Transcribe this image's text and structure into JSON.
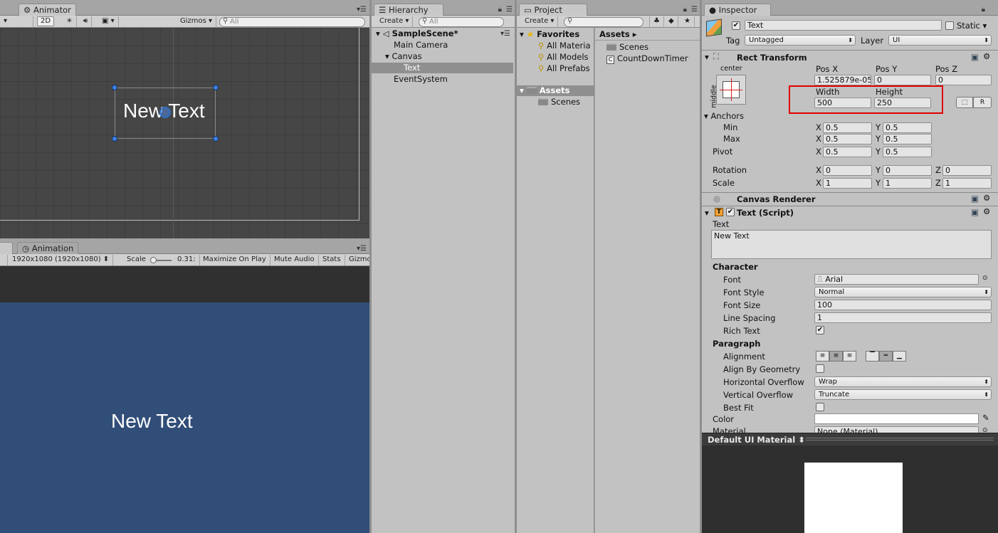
{
  "scene": {
    "tab": "Animator",
    "dim_btn": "2D",
    "gizmos": "Gizmos",
    "search_placeholder": "All",
    "text_label": "New Text"
  },
  "game": {
    "tab_animation": "Animation",
    "resolution": "1920x1080 (1920x1080)",
    "scale_label": "Scale",
    "scale_value": "0.31:",
    "maximize": "Maximize On Play",
    "mute": "Mute Audio",
    "stats": "Stats",
    "gizmos": "Gizmo",
    "text_label": "New Text",
    "bg_color": "#314e78"
  },
  "hierarchy": {
    "tab": "Hierarchy",
    "create": "Create",
    "search_placeholder": "All",
    "scene": "SampleScene*",
    "items": [
      "Main Camera",
      "Canvas",
      "Text",
      "EventSystem"
    ]
  },
  "project": {
    "tab": "Project",
    "create": "Create",
    "favorites": "Favorites",
    "fav_items": [
      "All Materia",
      "All Models",
      "All Prefabs"
    ],
    "assets_header": "Assets",
    "assets_sub": "Scenes",
    "breadcrumb": "Assets",
    "files": [
      "Scenes",
      "CountDownTimer"
    ]
  },
  "inspector": {
    "tab": "Inspector",
    "name": "Text",
    "static": "Static",
    "tag_label": "Tag",
    "tag": "Untagged",
    "layer_label": "Layer",
    "layer": "UI",
    "rect": {
      "title": "Rect Transform",
      "anchor_h": "center",
      "anchor_v": "middle",
      "posx_label": "Pos X",
      "posy_label": "Pos Y",
      "posz_label": "Pos Z",
      "posx": "1.525879e-05",
      "posy": "0",
      "posz": "0",
      "width_label": "Width",
      "height_label": "Height",
      "width": "500",
      "height": "250",
      "r_btn": "R",
      "anchors": "Anchors",
      "min": "Min",
      "max": "Max",
      "pivot": "Pivot",
      "rotation": "Rotation",
      "scale": "Scale",
      "x": "X",
      "y": "Y",
      "z": "Z",
      "min_x": "0.5",
      "min_y": "0.5",
      "max_x": "0.5",
      "max_y": "0.5",
      "pivot_x": "0.5",
      "pivot_y": "0.5",
      "rot_x": "0",
      "rot_y": "0",
      "rot_z": "0",
      "scale_x": "1",
      "scale_y": "1",
      "scale_z": "1"
    },
    "canvas_renderer": "Canvas Renderer",
    "text_script": {
      "title": "Text (Script)",
      "text_label": "Text",
      "text_value": "New Text",
      "character": "Character",
      "font_label": "Font",
      "font": "Arial",
      "style_label": "Font Style",
      "style": "Normal",
      "size_label": "Font Size",
      "size": "100",
      "spacing_label": "Line Spacing",
      "spacing": "1",
      "rich_label": "Rich Text",
      "paragraph": "Paragraph",
      "align_label": "Alignment",
      "geom_label": "Align By Geometry",
      "hover_label": "Horizontal Overflow",
      "hover": "Wrap",
      "vover_label": "Vertical Overflow",
      "vover": "Truncate",
      "best_label": "Best Fit",
      "color_label": "Color",
      "material_label": "Material",
      "material": "None (Material)"
    },
    "preview": "Default UI Material"
  },
  "colors": {
    "highlight": "#e00000",
    "selected": "#8fa8c8"
  }
}
